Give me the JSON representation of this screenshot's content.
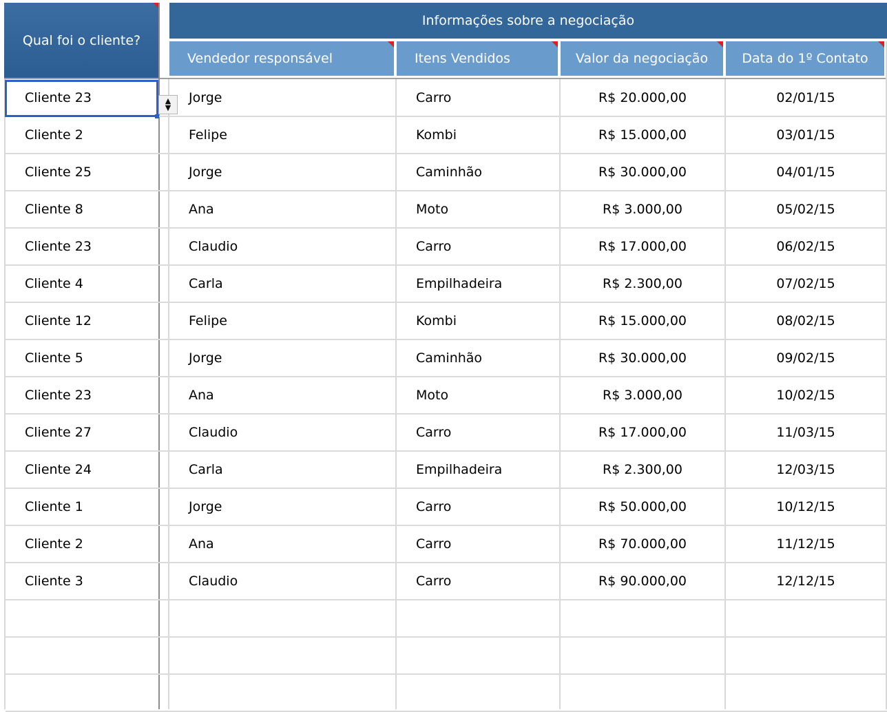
{
  "header": {
    "client_col": "Qual foi o cliente?",
    "group_title": "Informações sobre a negociação",
    "columns": [
      "Vendedor responsável",
      "Itens Vendidos",
      "Valor da negociação",
      "Data do 1º Contato"
    ]
  },
  "spinner_icons": {
    "up": "▲",
    "down": "▼"
  },
  "rows": [
    {
      "client": "Cliente 23",
      "seller": "Jorge",
      "item": "Carro",
      "value": "R$ 20.000,00",
      "date": "02/01/15"
    },
    {
      "client": "Cliente 2",
      "seller": "Felipe",
      "item": "Kombi",
      "value": "R$ 15.000,00",
      "date": "03/01/15"
    },
    {
      "client": "Cliente 25",
      "seller": "Jorge",
      "item": "Caminhão",
      "value": "R$ 30.000,00",
      "date": "04/01/15"
    },
    {
      "client": "Cliente 8",
      "seller": "Ana",
      "item": "Moto",
      "value": "R$ 3.000,00",
      "date": "05/02/15"
    },
    {
      "client": "Cliente 23",
      "seller": "Claudio",
      "item": "Carro",
      "value": "R$ 17.000,00",
      "date": "06/02/15"
    },
    {
      "client": "Cliente 4",
      "seller": "Carla",
      "item": "Empilhadeira",
      "value": "R$ 2.300,00",
      "date": "07/02/15"
    },
    {
      "client": "Cliente 12",
      "seller": "Felipe",
      "item": "Kombi",
      "value": "R$ 15.000,00",
      "date": "08/02/15"
    },
    {
      "client": "Cliente 5",
      "seller": "Jorge",
      "item": "Caminhão",
      "value": "R$ 30.000,00",
      "date": "09/02/15"
    },
    {
      "client": "Cliente 23",
      "seller": "Ana",
      "item": "Moto",
      "value": "R$ 3.000,00",
      "date": "10/02/15"
    },
    {
      "client": "Cliente 27",
      "seller": "Claudio",
      "item": "Carro",
      "value": "R$ 17.000,00",
      "date": "11/03/15"
    },
    {
      "client": "Cliente 24",
      "seller": "Carla",
      "item": "Empilhadeira",
      "value": "R$ 2.300,00",
      "date": "12/03/15"
    },
    {
      "client": "Cliente 1",
      "seller": "Jorge",
      "item": "Carro",
      "value": "R$ 50.000,00",
      "date": "10/12/15"
    },
    {
      "client": "Cliente 2",
      "seller": "Ana",
      "item": "Carro",
      "value": "R$ 70.000,00",
      "date": "11/12/15"
    },
    {
      "client": "Cliente 3",
      "seller": "Claudio",
      "item": "Carro",
      "value": "R$ 90.000,00",
      "date": "12/12/15"
    },
    {
      "client": "",
      "seller": "",
      "item": "",
      "value": "",
      "date": ""
    },
    {
      "client": "",
      "seller": "",
      "item": "",
      "value": "",
      "date": ""
    },
    {
      "client": "",
      "seller": "",
      "item": "",
      "value": "",
      "date": ""
    }
  ]
}
